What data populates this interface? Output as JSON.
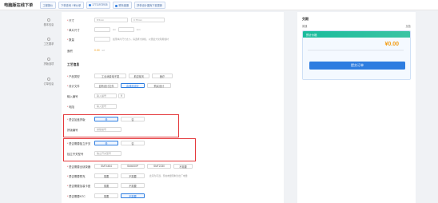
{
  "app_title": "电脑版在线下单",
  "topnav": {
    "items": [
      "工程报价",
      "下单查询 / 审价单",
      "17711973935",
      "联系客服",
      "拼单设计图库下载更新"
    ]
  },
  "sidebar": {
    "items": [
      "基本信息",
      "工艺要求",
      "拼版选项",
      "订单信息"
    ]
  },
  "form": {
    "length_label": "尺寸",
    "length_value": "8.5mm",
    "width_value": "0.75mm",
    "size_label": "单片尺寸",
    "size_unit1": "cm",
    "size_unit2": "mm",
    "qty_label": "数量",
    "qty_note": "如果单片尺寸太小，请选择大拼板，以便最大化利用板材",
    "area_label": "面积",
    "area_value": "0.00",
    "area_unit": "m²",
    "section_title": "工艺信息",
    "type_label": "产品类型",
    "type_options": [
      "工业消费电子类",
      "航空航天",
      "医疗"
    ],
    "design_label": "设计文件",
    "design_options": [
      "自有设计文件",
      "由我司设计",
      "购买设计"
    ],
    "input_label": "输入编号",
    "input_placeholder": "输入编号",
    "pcb_label": "电阻",
    "pcb_placeholder": "输入型号",
    "q1_label": "是否加盖拼版",
    "q1_yes": "是",
    "q1_no": "否",
    "q1_sub_label": "拼版编号",
    "q1_sub_placeholder": "拼版编号",
    "q2_label": "是否需要独立开关",
    "q2_yes": "是",
    "q2_no": "否",
    "q2_sub_label": "独立开关型号",
    "q2_sub_placeholder": "独立开关型号",
    "q3_label": "是否需要出烧录器",
    "q3_options": [
      "SMT4454",
      "SM4000P",
      "SMT2230",
      "不需要"
    ],
    "q4_label": "是否需要预充",
    "q4_options": [
      "需要",
      "不需要"
    ],
    "q4_note": "此项为可选，预充电量限制为出厂电量",
    "q5_label": "是否需要加装卡座",
    "q5_options": [
      "需要",
      "不需要"
    ],
    "q6_label": "是否需要NTC",
    "q6_options": [
      "需要",
      "不需要"
    ]
  },
  "right_panel": {
    "title": "交期",
    "row_left": "普通",
    "row_right": "加急",
    "card_head": "预计价格",
    "price": "¥0.00",
    "submit_label": "提交订单"
  }
}
